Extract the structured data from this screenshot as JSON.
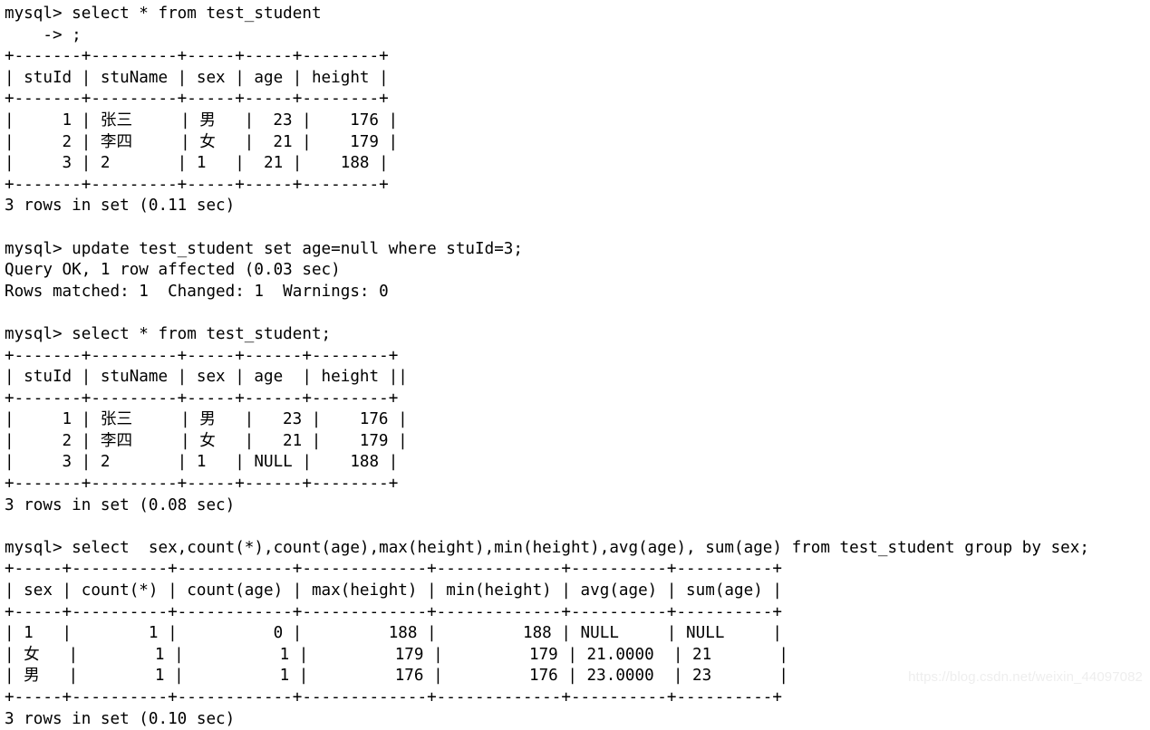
{
  "terminal": {
    "prompt": "mysql>",
    "continuation_prompt": "    ->",
    "colors": {
      "background": "#ffffff",
      "foreground": "#000000",
      "watermark": "#eeeeee"
    },
    "watermark": "https://blog.csdn.net/weixin_44097082",
    "lines": [
      "mysql> select * from test_student",
      "    -> ;",
      "+-------+---------+-----+-----+--------+",
      "| stuId | stuName | sex | age | height |",
      "+-------+---------+-----+-----+--------+",
      "|     1 | 张三     | 男   |  23 |    176 |",
      "|     2 | 李四     | 女   |  21 |    179 |",
      "|     3 | 2       | 1   |  21 |    188 |",
      "+-------+---------+-----+-----+--------+",
      "3 rows in set (0.11 sec)",
      "",
      "mysql> update test_student set age=null where stuId=3;",
      "Query OK, 1 row affected (0.03 sec)",
      "Rows matched: 1  Changed: 1  Warnings: 0",
      "",
      "mysql> select * from test_student;",
      "+-------+---------+-----+------+--------+",
      "| stuId | stuName | sex | age  | height ||",
      "+-------+---------+-----+------+--------+",
      "|     1 | 张三     | 男   |   23 |    176 |",
      "|     2 | 李四     | 女   |   21 |    179 |",
      "|     3 | 2       | 1   | NULL |    188 |",
      "+-------+---------+-----+------+--------+",
      "3 rows in set (0.08 sec)",
      "",
      "mysql> select  sex,count(*),count(age),max(height),min(height),avg(age), sum(age) from test_student group by sex;",
      "+-----+----------+------------+-------------+-------------+----------+----------+",
      "| sex | count(*) | count(age) | max(height) | min(height) | avg(age) | sum(age) |",
      "+-----+----------+------------+-------------+-------------+----------+----------+",
      "| 1   |        1 |          0 |         188 |         188 | NULL     | NULL     |",
      "| 女   |        1 |          1 |         179 |         179 | 21.0000  | 21       |",
      "| 男   |        1 |          1 |         176 |         176 | 23.0000  | 23       |",
      "+-----+----------+------------+-------------+-------------+----------+----------+",
      "3 rows in set (0.10 sec)"
    ],
    "queries": [
      {
        "sql": "select * from test_student ;",
        "result_table": {
          "columns": [
            "stuId",
            "stuName",
            "sex",
            "age",
            "height"
          ],
          "rows": [
            [
              "1",
              "张三",
              "男",
              "23",
              "176"
            ],
            [
              "2",
              "李四",
              "女",
              "21",
              "179"
            ],
            [
              "3",
              "2",
              "1",
              "21",
              "188"
            ]
          ],
          "status": "3 rows in set (0.11 sec)"
        }
      },
      {
        "sql": "update test_student set age=null where stuId=3;",
        "status_lines": [
          "Query OK, 1 row affected (0.03 sec)",
          "Rows matched: 1  Changed: 1  Warnings: 0"
        ]
      },
      {
        "sql": "select * from test_student;",
        "result_table": {
          "columns": [
            "stuId",
            "stuName",
            "sex",
            "age",
            "height"
          ],
          "rows": [
            [
              "1",
              "张三",
              "男",
              "23",
              "176"
            ],
            [
              "2",
              "李四",
              "女",
              "21",
              "179"
            ],
            [
              "3",
              "2",
              "1",
              "NULL",
              "188"
            ]
          ],
          "status": "3 rows in set (0.08 sec)"
        }
      },
      {
        "sql": "select  sex,count(*),count(age),max(height),min(height),avg(age), sum(age) from test_student group by sex;",
        "result_table": {
          "columns": [
            "sex",
            "count(*)",
            "count(age)",
            "max(height)",
            "min(height)",
            "avg(age)",
            "sum(age)"
          ],
          "rows": [
            [
              "1",
              "1",
              "0",
              "188",
              "188",
              "NULL",
              "NULL"
            ],
            [
              "女",
              "1",
              "1",
              "179",
              "179",
              "21.0000",
              "21"
            ],
            [
              "男",
              "1",
              "1",
              "176",
              "176",
              "23.0000",
              "23"
            ]
          ],
          "status": "3 rows in set (0.10 sec)"
        }
      }
    ]
  }
}
